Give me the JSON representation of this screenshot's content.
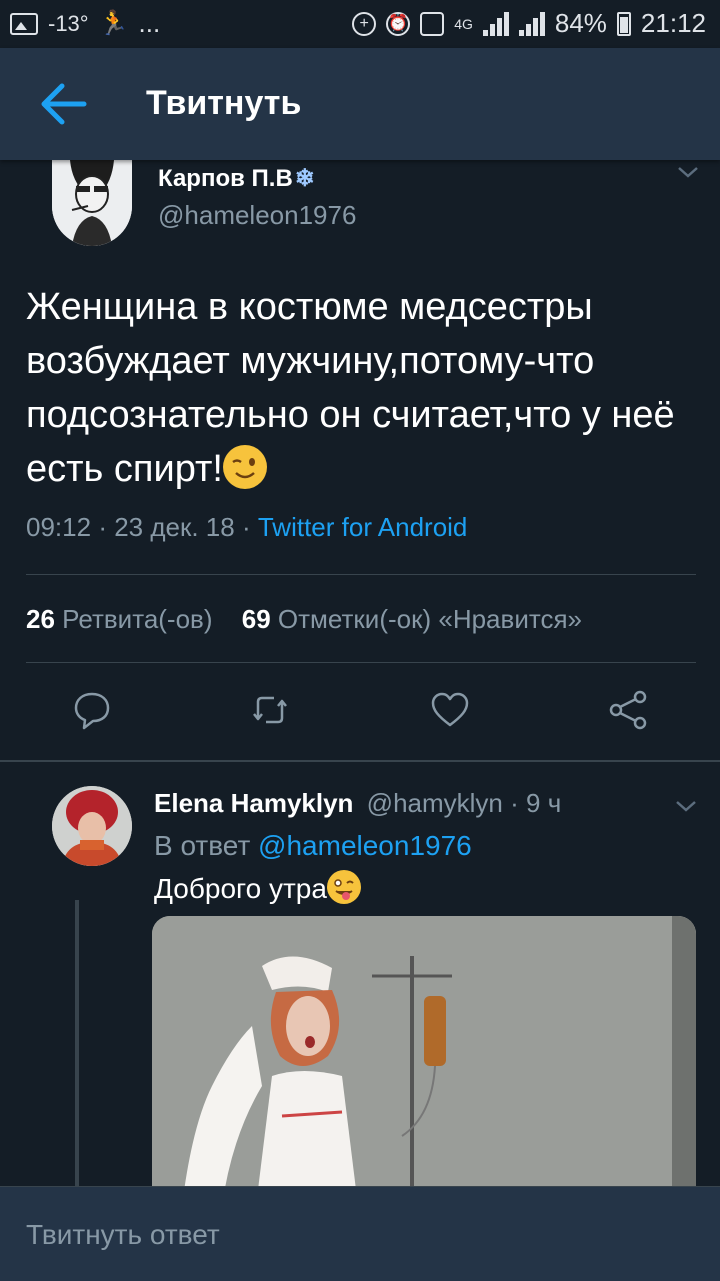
{
  "status_bar": {
    "temperature": "-13°",
    "more": "...",
    "network": "4G",
    "battery": "84%",
    "time": "21:12"
  },
  "header": {
    "title": "Твитнуть"
  },
  "tweet": {
    "author_name": "Карпов П.В",
    "author_name_emoji": "❄",
    "handle": "@hameleon1976",
    "text": "Женщина в костюме медсестры возбуждает мужчину,потому-что подсознательно он считает,что у неё есть спирт!",
    "time": "09:12",
    "date": "23 дек. 18",
    "source": "Twitter for Android",
    "retweets_count": "26",
    "retweets_label": "Ретвита(-ов)",
    "likes_count": "69",
    "likes_label": "Отметки(-ок) «Нравится»",
    "actions": [
      "reply-icon",
      "retweet-icon",
      "like-icon",
      "share-icon"
    ]
  },
  "reply": {
    "author_name": "Elena Hamyklyn",
    "handle": "@hamyklyn",
    "time_ago": "9 ч",
    "in_reply_prefix": "В ответ",
    "in_reply_handle": "@hameleon1976",
    "text": "Доброго утра"
  },
  "composer": {
    "placeholder": "Твитнуть ответ"
  },
  "colors": {
    "background": "#141d26",
    "appbar": "#243447",
    "accent": "#1da1f2",
    "secondary_text": "#8899a6"
  }
}
